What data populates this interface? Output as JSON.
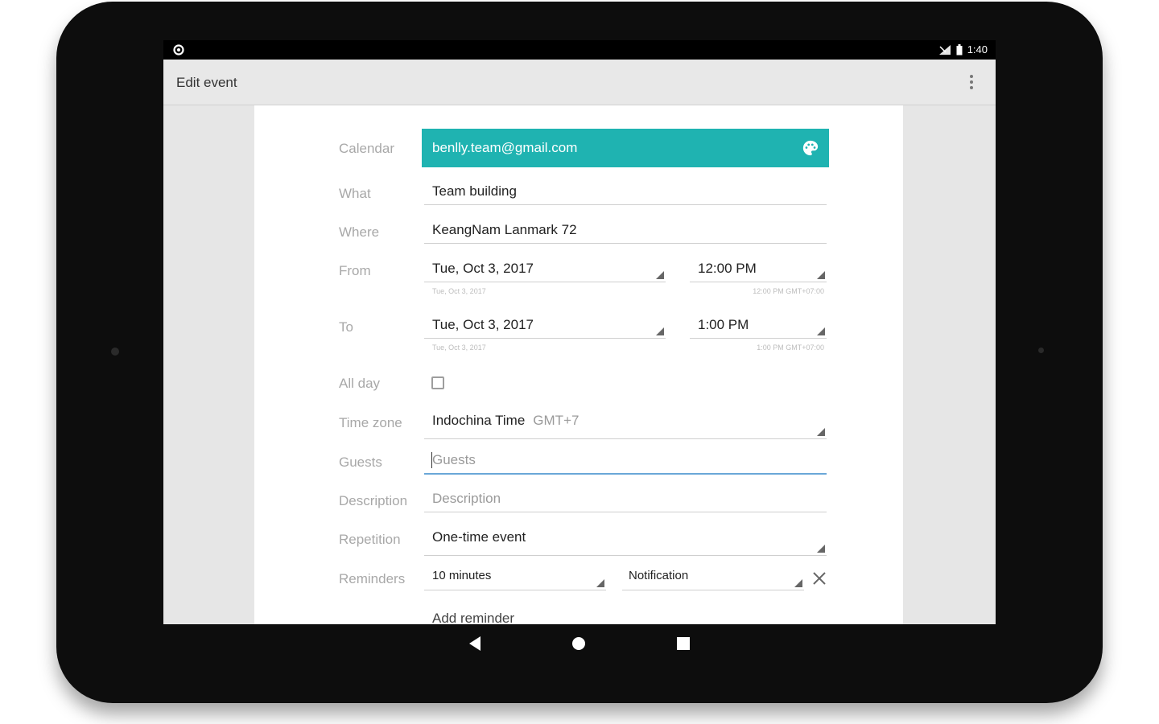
{
  "status_bar": {
    "left_icon": "settings-icon",
    "right_icons": [
      "signal-off-icon",
      "battery-icon"
    ],
    "time": "1:40"
  },
  "app_bar": {
    "title": "Edit event",
    "menu_icon": "overflow-menu-icon"
  },
  "form": {
    "calendar": {
      "label": "Calendar",
      "value": "benlly.team@gmail.com",
      "icon": "palette-icon",
      "color": "#1fb3b1"
    },
    "what": {
      "label": "What",
      "value": "Team building"
    },
    "where": {
      "label": "Where",
      "value": "KeangNam Lanmark 72"
    },
    "from": {
      "label": "From",
      "date": "Tue, Oct 3, 2017",
      "time": "12:00 PM",
      "date_sub": "Tue, Oct 3, 2017",
      "time_sub": "12:00 PM GMT+07:00"
    },
    "to": {
      "label": "To",
      "date": "Tue, Oct 3, 2017",
      "time": "1:00 PM",
      "date_sub": "Tue, Oct 3, 2017",
      "time_sub": "1:00 PM GMT+07:00"
    },
    "all_day": {
      "label": "All day",
      "checked": false
    },
    "time_zone": {
      "label": "Time zone",
      "value": "Indochina Time",
      "offset": "GMT+7"
    },
    "guests": {
      "label": "Guests",
      "placeholder": "Guests"
    },
    "description": {
      "label": "Description",
      "placeholder": "Description"
    },
    "repetition": {
      "label": "Repetition",
      "value": "One-time event"
    },
    "reminders": {
      "label": "Reminders",
      "time": "10 minutes",
      "method": "Notification",
      "remove_icon": "close-icon",
      "add_label": "Add reminder"
    }
  },
  "nav_bar": {
    "back_icon": "back-icon",
    "home_icon": "home-icon",
    "recents_icon": "recents-icon"
  }
}
